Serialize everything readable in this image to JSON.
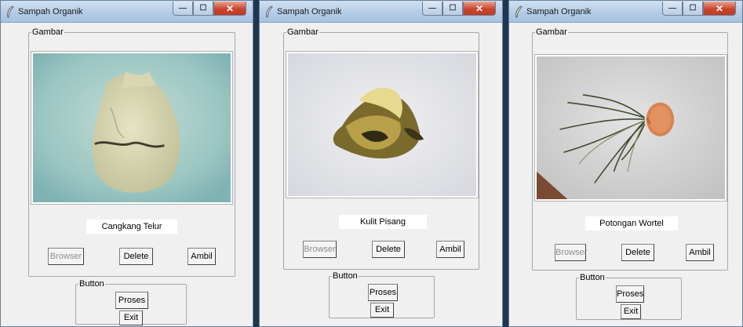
{
  "windows": [
    {
      "title": "Sampah Organik",
      "gambar_legend": "Gambar",
      "label": "Cangkang Telur",
      "button_legend": "Button",
      "buttons": {
        "browser": "Browser",
        "delete": "Delete",
        "ambil": "Ambil",
        "proses": "Proses",
        "exit": "Exit"
      },
      "image_subject": "egg shell"
    },
    {
      "title": "Sampah Organik",
      "gambar_legend": "Gambar",
      "label": "Kulit Pisang",
      "button_legend": "Button",
      "buttons": {
        "browser": "Browser",
        "delete": "Delete",
        "ambil": "Ambil",
        "proses": "Proses",
        "exit": "Exit"
      },
      "image_subject": "banana peel"
    },
    {
      "title": "Sampah Organik",
      "gambar_legend": "Gambar",
      "label": "Potongan Wortel",
      "button_legend": "Button",
      "buttons": {
        "browser": "Browser",
        "delete": "Delete",
        "ambil": "Ambil",
        "proses": "Proses",
        "exit": "Exit"
      },
      "image_subject": "carrot slice with roots"
    }
  ],
  "window_controls": {
    "minimize": "—",
    "maximize": "☐",
    "close": "✕"
  },
  "colors": {
    "title_bar": "#b3cbe6",
    "close_button": "#c9452c",
    "window_bg": "#f0f0f0"
  }
}
